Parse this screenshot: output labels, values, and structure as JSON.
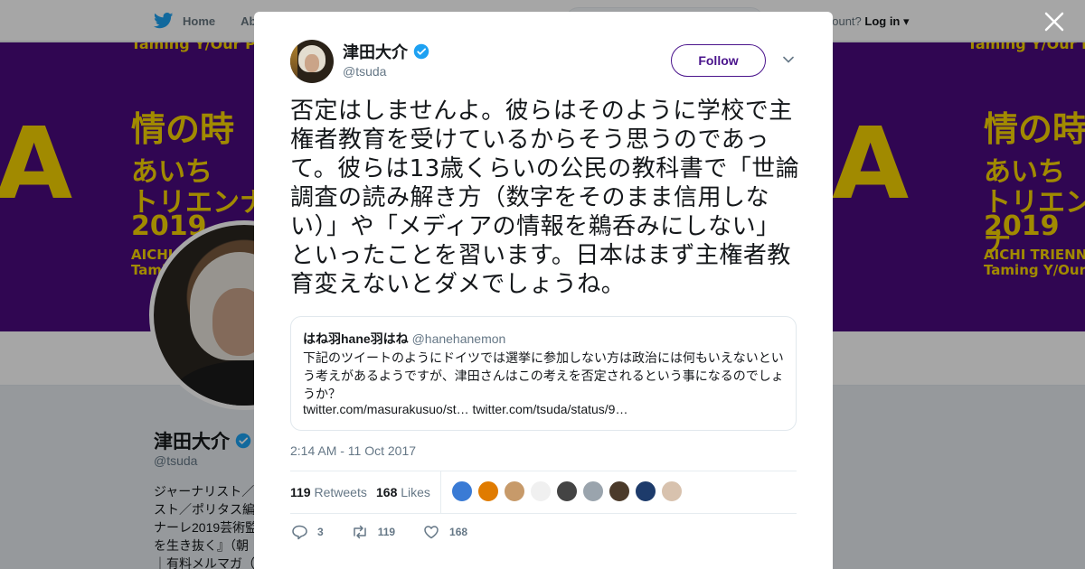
{
  "topbar": {
    "home_label": "Home",
    "about_label": "Abo",
    "account_prompt": "account?",
    "login_label": "Log in"
  },
  "banner": {
    "left_poster": {
      "l0": "Taming Y/Our Pa",
      "l1": "情の時",
      "l2": "あいち",
      "l3": "トリエンナ",
      "l4": "2019",
      "l5": "AICHI TRIEN",
      "l6": "Taming Y/Our"
    },
    "right_poster": {
      "l0": "Taming Y/Our Pa",
      "l1": "情の時",
      "l2": "あいち",
      "l3": "トリエンナ",
      "l4": "2019",
      "l5": "AICHI TRIENNA",
      "l6": "Taming Y/Our"
    },
    "colors": {
      "bg": "#4a0a7e",
      "text": "#f8d500"
    }
  },
  "profile": {
    "name": "津田大介",
    "handle": "@tsuda",
    "bio": "ジャーナリスト／\nスト／ポリタス編\nナーレ2019芸術監\nを生き抜く』（朝\n｜有料メルマガ（"
  },
  "tweet": {
    "author_name": "津田大介",
    "author_handle": "@tsuda",
    "follow_label": "Follow",
    "text": "否定はしませんよ。彼らはそのように学校で主権者教育を受けているからそう思うのであって。彼らは13歳くらいの公民の教科書で「世論調査の読み解き方（数字をそのまま信用しない）」や「メディアの情報を鵜呑みにしない」といったことを習います。日本はまず主権者教育変えないとダメでしょうね。",
    "quote": {
      "name": "はね羽hane羽はね",
      "handle": "@hanehanemon",
      "text": "下記のツイートのようにドイツでは選挙に参加しない方は政治には何もいえないという考えがあるようですが、津田さんはこの考えを否定されるという事になるのでしょうか？",
      "links": "twitter.com/masurakusuo/st… twitter.com/tsuda/status/9…"
    },
    "timestamp": "2:14 AM - 11 Oct 2017",
    "retweets_count": "119",
    "retweets_label": "Retweets",
    "likes_count": "168",
    "likes_label": "Likes",
    "liker_colors": [
      "#3a7bd5",
      "#e07b00",
      "#c79a6a",
      "#f0f0f0",
      "#444444",
      "#9aa4ad",
      "#4b3a2a",
      "#1d3b6b",
      "#d8c2ae"
    ],
    "actions": {
      "reply_count": "3",
      "retweet_count": "119",
      "like_count": "168"
    }
  },
  "colors": {
    "accent": "#4a148c",
    "verified": "#1da1f2",
    "text_secondary": "#657786"
  }
}
